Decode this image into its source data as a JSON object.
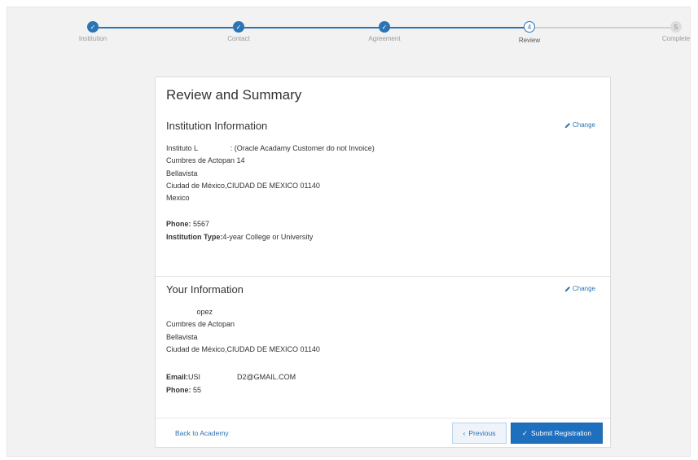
{
  "steps": [
    {
      "label": "Institution",
      "state": "done",
      "marker": "✓"
    },
    {
      "label": "Contact",
      "state": "done",
      "marker": "✓"
    },
    {
      "label": "Agreement",
      "state": "done",
      "marker": "✓"
    },
    {
      "label": "Review",
      "state": "current",
      "marker": "4"
    },
    {
      "label": "Complete",
      "state": "todo",
      "marker": "5"
    }
  ],
  "card": {
    "title": "Review and Summary"
  },
  "institution": {
    "title": "Institution Information",
    "change_label": "Change",
    "address_lines": [
      "Instituto L                : (Oracle Acadamy Customer do not Invoice)",
      "Cumbres de Actopan 14",
      "Bellavista",
      "Ciudad de México,CIUDAD DE MEXICO 01140",
      "Mexico"
    ],
    "phone_label": "Phone:",
    "phone_value": " 5567",
    "type_label": "Institution Type:",
    "type_value": "4-year College or University"
  },
  "your_info": {
    "title": "Your Information",
    "change_label": "Change",
    "address_lines": [
      "               opez",
      "Cumbres de Actopan",
      "Bellavista",
      "Ciudad de México,CIUDAD DE MEXICO 01140"
    ],
    "email_label": "Email:",
    "email_value": "USI                  D2@GMAIL.COM",
    "phone_label": "Phone:",
    "phone_value": " 55"
  },
  "footer": {
    "back_label": "Back to Academy",
    "previous_label": "Previous",
    "submit_label": "Submit Registration"
  },
  "colors": {
    "accent": "#2c74b3",
    "submit_bg": "#1f6fbf",
    "frame_bg": "#f2f2f2"
  }
}
